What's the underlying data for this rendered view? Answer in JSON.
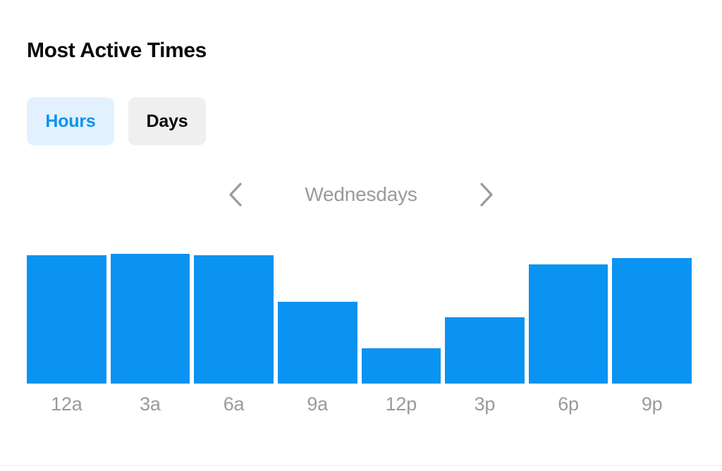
{
  "panel": {
    "title": "Most Active Times"
  },
  "toggle": {
    "hours_label": "Hours",
    "days_label": "Days",
    "active": "Hours"
  },
  "day_nav": {
    "prev_icon": "chevron-left-icon",
    "next_icon": "chevron-right-icon",
    "current_day": "Wednesdays"
  },
  "colors": {
    "bar": "#0a93f0",
    "active_tab_bg": "#e2f1fd",
    "active_tab_text": "#0a93f0",
    "inactive_tab_bg": "#efefef",
    "inactive_tab_text": "#0a0a0a",
    "axis_label": "#9a9a9a",
    "title": "#0a0a0a",
    "background": "#ffffff"
  },
  "chart_data": {
    "type": "bar",
    "title": "Most Active Times",
    "subtitle": "Wednesdays",
    "xlabel": "",
    "ylabel": "",
    "categories": [
      "12a",
      "3a",
      "6a",
      "9a",
      "12p",
      "3p",
      "6p",
      "9p"
    ],
    "values": [
      99,
      100,
      99,
      63,
      27,
      51,
      92,
      97
    ],
    "ylim": [
      0,
      100
    ],
    "grid": false,
    "legend": false,
    "bar_color": "#0a93f0"
  }
}
